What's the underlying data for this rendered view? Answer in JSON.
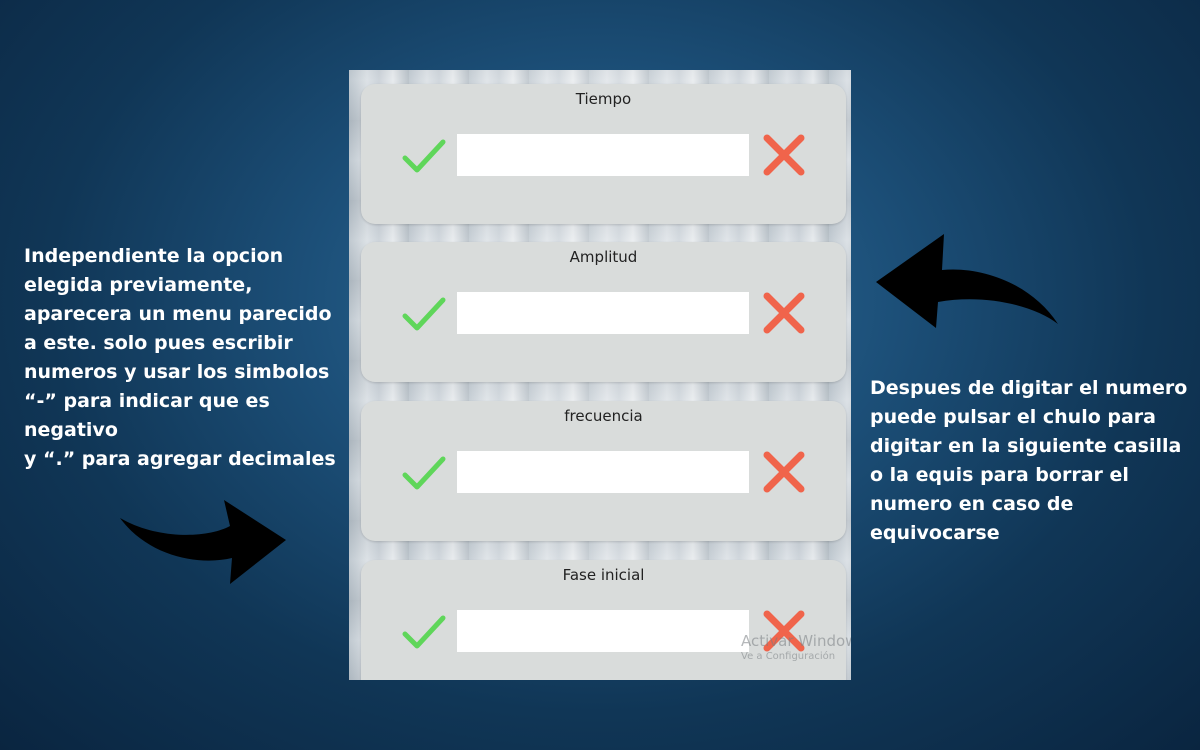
{
  "annotations": {
    "left_text": "Independiente la opcion\nelegida previamente,\naparecera un menu parecido\na este. solo pues escribir\nnumeros y usar los simbolos\n“-” para indicar que es negativo\ny  “.” para agregar decimales",
    "right_text": "Despues de digitar el numero\npuede pulsar el chulo para\ndigitar en la siguiente casilla\no la equis para borrar el\nnumero en caso de\nequivocarse"
  },
  "form": {
    "cards": [
      {
        "label": "Tiempo",
        "value": ""
      },
      {
        "label": "Amplitud",
        "value": ""
      },
      {
        "label": "frecuencia",
        "value": ""
      },
      {
        "label": "Fase inicial",
        "value": ""
      }
    ]
  },
  "watermark": {
    "title": "Activar Windows",
    "subtitle": "Ve a Configuración"
  },
  "colors": {
    "check": "#5fd65a",
    "cross": "#f0644b",
    "card": "#d9dcdb"
  },
  "icons": {
    "confirm": "check-icon",
    "clear": "close-icon",
    "arrow_right": "curved-arrow-right-icon",
    "arrow_left": "curved-arrow-left-icon"
  }
}
